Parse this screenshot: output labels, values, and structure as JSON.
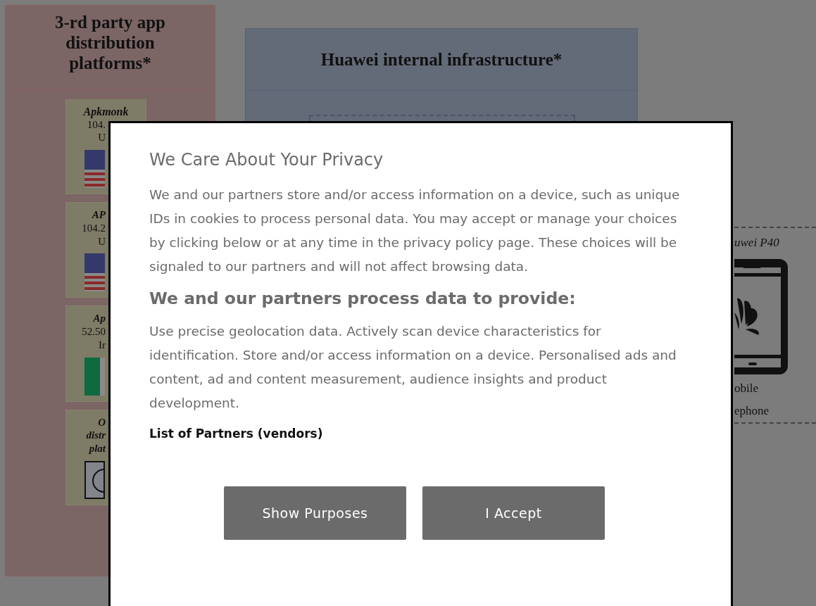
{
  "figure": {
    "left_panel": {
      "title": "3-rd party app distribution platforms*",
      "cards": [
        {
          "title": "Apkmonk",
          "lines": [
            {
              "text": "104.",
              "emphasis": false
            },
            {
              "text": "U",
              "emphasis": false
            }
          ],
          "kind": "us-flag"
        },
        {
          "lines": [
            {
              "text": "AP",
              "emphasis": true
            },
            {
              "text": "104.2",
              "emphasis": false
            },
            {
              "text": "U",
              "emphasis": false
            }
          ],
          "kind": "us-flag"
        },
        {
          "lines": [
            {
              "text": "Ap",
              "emphasis": true
            },
            {
              "text": "52.50",
              "emphasis": false
            },
            {
              "text": "Ir",
              "emphasis": false
            }
          ],
          "kind": "ie-flag"
        },
        {
          "lines": [
            {
              "text": "O",
              "emphasis": true
            },
            {
              "text": "distr",
              "emphasis": true
            },
            {
              "text": "plat",
              "emphasis": true
            }
          ],
          "kind": "globe"
        }
      ]
    },
    "center_panel": {
      "title": "Huawei internal infrastructure*"
    },
    "device": {
      "label": "uwei P40",
      "caption": [
        "obile",
        "ephone"
      ]
    }
  },
  "consent": {
    "title": "We Care About Your Privacy",
    "intro": "We and our partners store and/or access information on a device, such as unique IDs in cookies to process personal data. You may accept or manage your choices by clicking below or at any time in the privacy policy page. These choices will be signaled to our partners and will not affect browsing data.",
    "heading": "We and our partners process data to provide:",
    "purposes": "Use precise geolocation data. Actively scan device characteristics for identification. Store and/or access information on a device. Personalised ads and content, ad and content measurement, audience insights and product development.",
    "vendors_link": "List of Partners (vendors)",
    "buttons": [
      "Show Purposes",
      "I Accept"
    ]
  }
}
